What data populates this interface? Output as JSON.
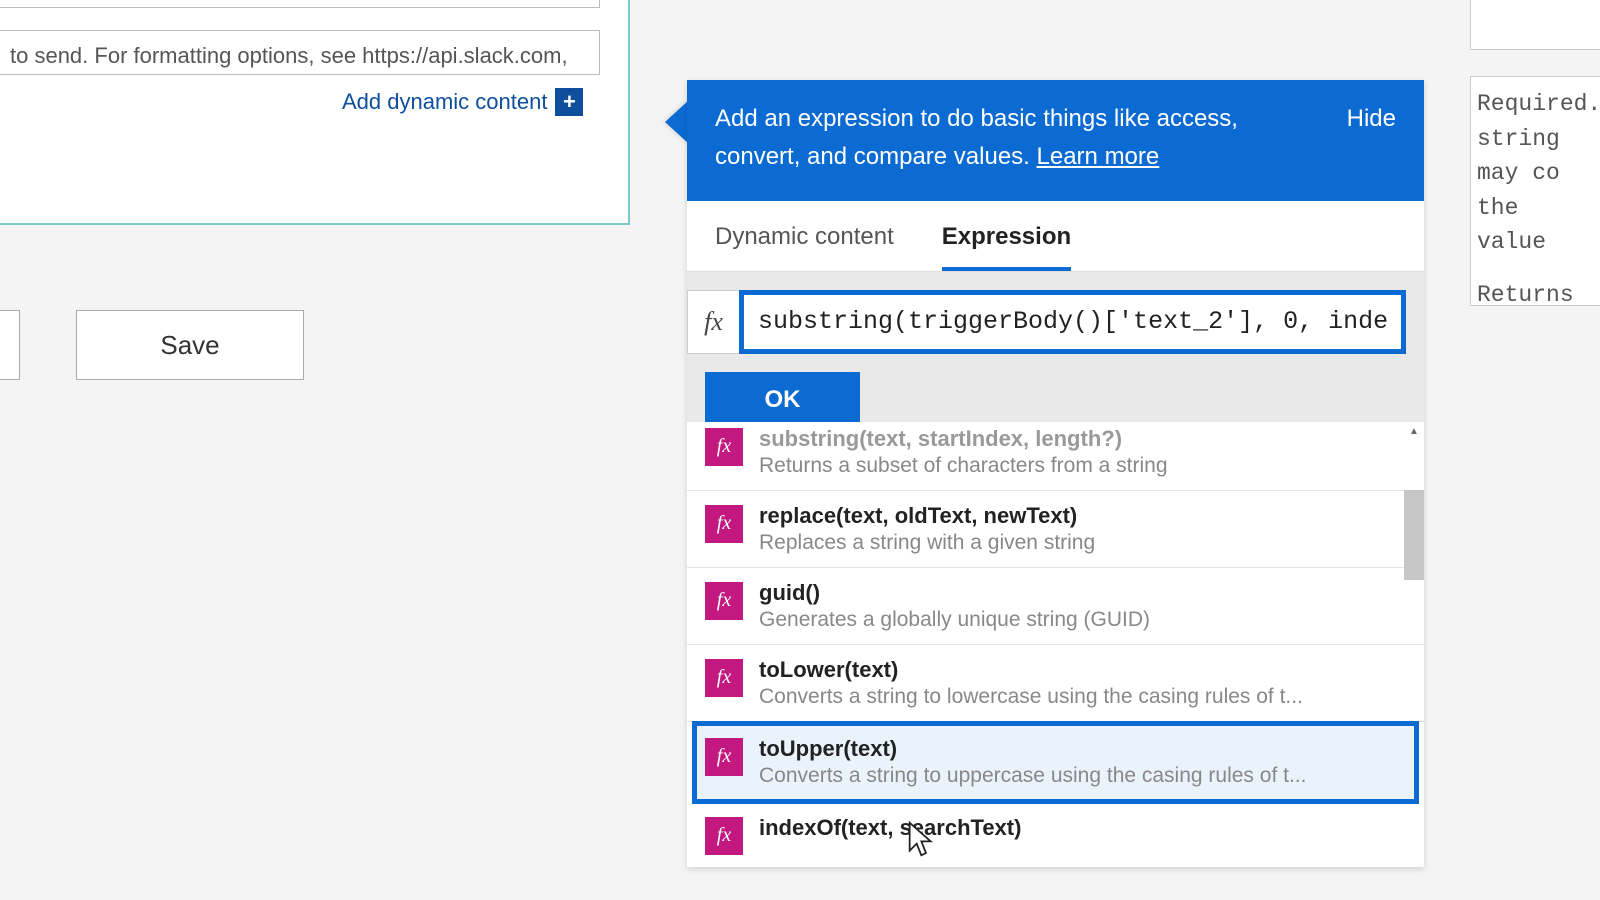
{
  "left": {
    "placeholder": "to send. For formatting options, see https://api.slack.com,",
    "addDynamic": "Add dynamic content",
    "save": "Save"
  },
  "popout": {
    "headerTextA": "Add an expression to do basic things like access, convert, and compare values. ",
    "learnMore": "Learn more",
    "hide": "Hide",
    "tabs": {
      "dynamic": "Dynamic content",
      "expression": "Expression"
    },
    "fx": "fx",
    "expression": "substring(triggerBody()['text_2'], 0, inde",
    "ok": "OK",
    "functions": [
      {
        "sig": "substring(text, startIndex, length?)",
        "desc": "Returns a subset of characters from a string"
      },
      {
        "sig": "replace(text, oldText, newText)",
        "desc": "Replaces a string with a given string"
      },
      {
        "sig": "guid()",
        "desc": "Generates a globally unique string (GUID)"
      },
      {
        "sig": "toLower(text)",
        "desc": "Converts a string to lowercase using the casing rules of t..."
      },
      {
        "sig": "toUpper(text)",
        "desc": "Converts a string to uppercase using the casing rules of t..."
      },
      {
        "sig": "indexOf(text, searchText)",
        "desc": ""
      }
    ]
  },
  "right": {
    "line1": "Required.",
    "line2": "string",
    "line3": "may   co",
    "line4": "the value",
    "line5": "Returns"
  }
}
